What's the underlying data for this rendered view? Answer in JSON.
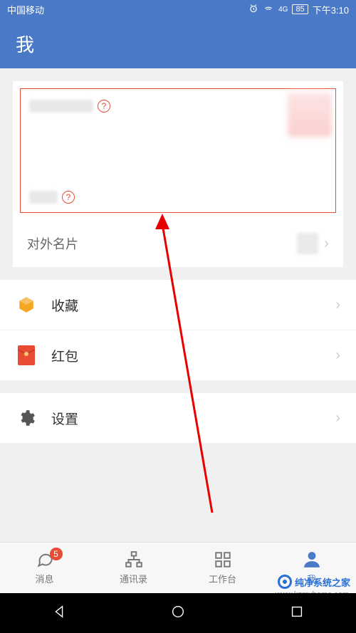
{
  "status": {
    "carrier": "中国移动",
    "signal_type": "4G",
    "battery": "85",
    "time": "下午3:10"
  },
  "header": {
    "title": "我"
  },
  "profile": {
    "help1_label": "?",
    "help2_label": "?"
  },
  "external_card": {
    "label": "对外名片"
  },
  "menu": {
    "favorites": "收藏",
    "red_packet": "红包",
    "settings": "设置"
  },
  "nav": {
    "messages": {
      "label": "消息",
      "badge": "5"
    },
    "contacts": {
      "label": "通讯录"
    },
    "workbench": {
      "label": "工作台"
    },
    "me": {
      "label": "我"
    }
  },
  "watermark": {
    "brand": "纯净系统之家",
    "url": "www.kzmyhome.com"
  }
}
